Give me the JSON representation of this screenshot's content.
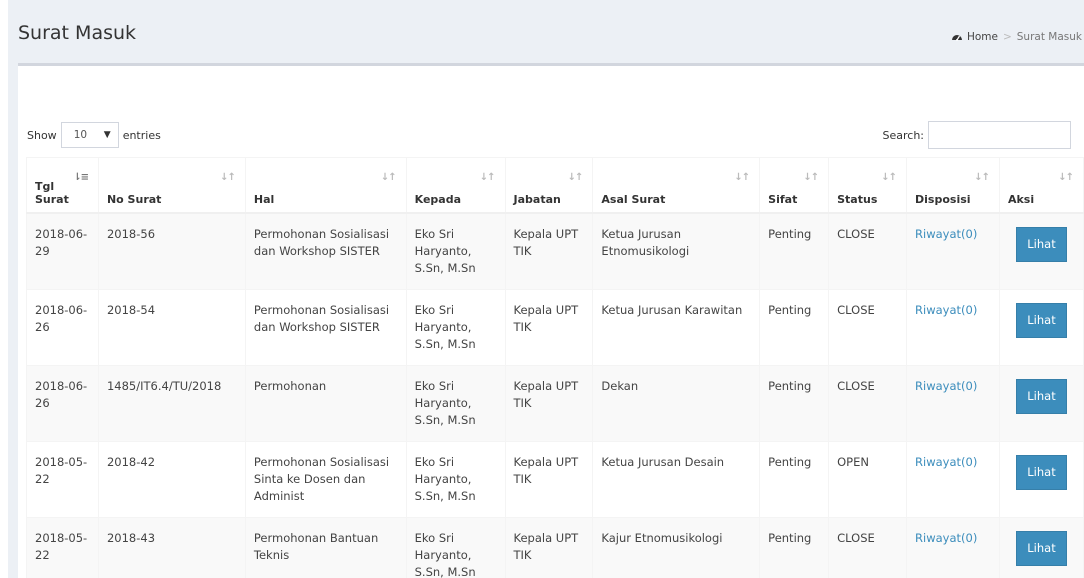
{
  "header": {
    "title": "Surat Masuk",
    "breadcrumb": {
      "home_icon": "dashboard-icon",
      "home": "Home",
      "sep": ">",
      "current": "Surat Masuk"
    }
  },
  "controls": {
    "show_label": "Show",
    "entries_value": "10",
    "entries_label": "entries",
    "search_label": "Search:",
    "search_value": ""
  },
  "table": {
    "headers": {
      "tgl_surat": "Tgl Surat",
      "no_surat": "No Surat",
      "hal": "Hal",
      "kepada": "Kepada",
      "jabatan": "Jabatan",
      "asal_surat": "Asal Surat",
      "sifat": "Sifat",
      "status": "Status",
      "disposisi": "Disposisi",
      "aksi": "Aksi"
    },
    "rows": [
      {
        "tgl": "2018-06-29",
        "no": "2018-56",
        "hal": "Permohonan Sosialisasi dan Workshop SISTER",
        "kepada": "Eko Sri Haryanto, S.Sn, M.Sn",
        "jabatan": "Kepala UPT TIK",
        "asal": "Ketua Jurusan Etnomusikologi",
        "sifat": "Penting",
        "status": "CLOSE",
        "disposisi": "Riwayat(0)",
        "aksi": "Lihat"
      },
      {
        "tgl": "2018-06-26",
        "no": "2018-54",
        "hal": "Permohonan Sosialisasi dan Workshop SISTER",
        "kepada": "Eko Sri Haryanto, S.Sn, M.Sn",
        "jabatan": "Kepala UPT TIK",
        "asal": "Ketua Jurusan Karawitan",
        "sifat": "Penting",
        "status": "CLOSE",
        "disposisi": "Riwayat(0)",
        "aksi": "Lihat"
      },
      {
        "tgl": "2018-06-26",
        "no": "1485/IT6.4/TU/2018",
        "hal": "Permohonan",
        "kepada": "Eko Sri Haryanto, S.Sn, M.Sn",
        "jabatan": "Kepala UPT TIK",
        "asal": "Dekan",
        "sifat": "Penting",
        "status": "CLOSE",
        "disposisi": "Riwayat(0)",
        "aksi": "Lihat"
      },
      {
        "tgl": "2018-05-22",
        "no": "2018-42",
        "hal": "Permohonan Sosialisasi Sinta ke Dosen dan Administ",
        "kepada": "Eko Sri Haryanto, S.Sn, M.Sn",
        "jabatan": "Kepala UPT TIK",
        "asal": "Ketua Jurusan Desain",
        "sifat": "Penting",
        "status": "OPEN",
        "disposisi": "Riwayat(0)",
        "aksi": "Lihat"
      },
      {
        "tgl": "2018-05-22",
        "no": "2018-43",
        "hal": "Permohonan Bantuan Teknis",
        "kepada": "Eko Sri Haryanto, S.Sn, M.Sn",
        "jabatan": "Kepala UPT TIK",
        "asal": "Kajur Etnomusikologi",
        "sifat": "Penting",
        "status": "CLOSE",
        "disposisi": "Riwayat(0)",
        "aksi": "Lihat"
      }
    ]
  },
  "colors": {
    "accent": "#3c8dbc",
    "background": "#ecf0f5"
  }
}
